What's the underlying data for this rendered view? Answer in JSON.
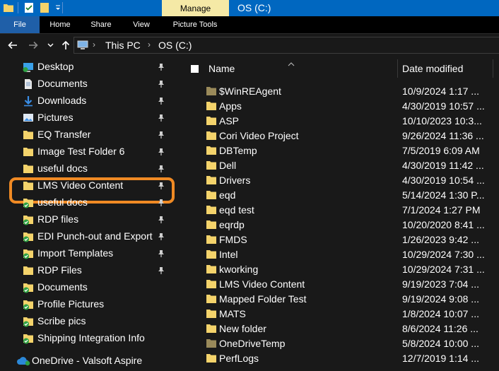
{
  "titlebar": {
    "manage_label": "Manage",
    "window_title": "OS (C:)",
    "quick_access": [
      "properties-icon",
      "new-folder-icon",
      "customize-dropdown-icon"
    ]
  },
  "ribbon": {
    "tabs": [
      "File",
      "Home",
      "Share",
      "View",
      "Picture Tools"
    ]
  },
  "address_bar": {
    "breadcrumbs": [
      "This PC",
      "OS (C:)"
    ]
  },
  "sidebar": {
    "items": [
      {
        "label": "Desktop",
        "icon": "desktop-icon",
        "pinned": true
      },
      {
        "label": "Documents",
        "icon": "documents-icon",
        "pinned": true
      },
      {
        "label": "Downloads",
        "icon": "downloads-icon",
        "pinned": true
      },
      {
        "label": "Pictures",
        "icon": "pictures-icon",
        "pinned": true
      },
      {
        "label": "EQ Transfer",
        "icon": "folder-icon",
        "pinned": true,
        "highlighted": true
      },
      {
        "label": "Image Test Folder 6",
        "icon": "folder-icon",
        "pinned": true
      },
      {
        "label": "useful docs",
        "icon": "folder-icon",
        "pinned": true
      },
      {
        "label": "LMS Video Content",
        "icon": "folder-icon",
        "pinned": true
      },
      {
        "label": "useful docs",
        "icon": "synced-folder-icon",
        "pinned": true
      },
      {
        "label": "RDP files",
        "icon": "synced-folder-icon",
        "pinned": true
      },
      {
        "label": "EDI Punch-out and Export",
        "icon": "synced-folder-icon",
        "pinned": true
      },
      {
        "label": "Import Templates",
        "icon": "synced-folder-icon",
        "pinned": true
      },
      {
        "label": "RDP Files",
        "icon": "folder-icon",
        "pinned": true
      },
      {
        "label": "Documents",
        "icon": "synced-folder-icon",
        "pinned": false
      },
      {
        "label": "Profile Pictures",
        "icon": "synced-folder-icon",
        "pinned": false
      },
      {
        "label": "Scribe pics",
        "icon": "synced-folder-icon",
        "pinned": false
      },
      {
        "label": "Shipping Integration Info",
        "icon": "synced-folder-icon",
        "pinned": false
      }
    ],
    "onedrive_label": "OneDrive - Valsoft Aspire"
  },
  "filelist": {
    "columns": [
      "Name",
      "Date modified"
    ],
    "rows": [
      {
        "name": "$WinREAgent",
        "date": "10/9/2024 1:17 ...",
        "dim": true
      },
      {
        "name": "Apps",
        "date": "4/30/2019 10:57 ...",
        "dim": false
      },
      {
        "name": "ASP",
        "date": "10/10/2023 10:3...",
        "dim": false
      },
      {
        "name": "Cori Video Project",
        "date": "9/26/2024 11:36 ...",
        "dim": false
      },
      {
        "name": "DBTemp",
        "date": "7/5/2019 6:09 AM",
        "dim": false
      },
      {
        "name": "Dell",
        "date": "4/30/2019 11:42 ...",
        "dim": false
      },
      {
        "name": "Drivers",
        "date": "4/30/2019 10:54 ...",
        "dim": false
      },
      {
        "name": "eqd",
        "date": "5/14/2024 1:30 P...",
        "dim": false
      },
      {
        "name": "eqd test",
        "date": "7/1/2024 1:27 PM",
        "dim": false
      },
      {
        "name": "eqrdp",
        "date": "10/20/2020 8:41 ...",
        "dim": false
      },
      {
        "name": "FMDS",
        "date": "1/26/2023 9:42 ...",
        "dim": false
      },
      {
        "name": "Intel",
        "date": "10/29/2024 7:30 ...",
        "dim": false
      },
      {
        "name": "kworking",
        "date": "10/29/2024 7:31 ...",
        "dim": false
      },
      {
        "name": "LMS Video Content",
        "date": "9/19/2023 7:04 ...",
        "dim": false
      },
      {
        "name": "Mapped Folder Test",
        "date": "9/19/2024 9:08 ...",
        "dim": false
      },
      {
        "name": "MATS",
        "date": "1/8/2024 10:07 ...",
        "dim": false
      },
      {
        "name": "New folder",
        "date": "8/6/2024 11:26 ...",
        "dim": false
      },
      {
        "name": "OneDriveTemp",
        "date": "5/8/2024 10:00 ...",
        "dim": true
      },
      {
        "name": "PerfLogs",
        "date": "12/7/2019 1:14 ...",
        "dim": false
      }
    ]
  },
  "colors": {
    "titlebar": "#0067c0",
    "manage_tab": "#f5e9a6",
    "highlight_ring": "#f08a24",
    "folder": "#f4d36b",
    "sync_check": "#2ea043"
  }
}
